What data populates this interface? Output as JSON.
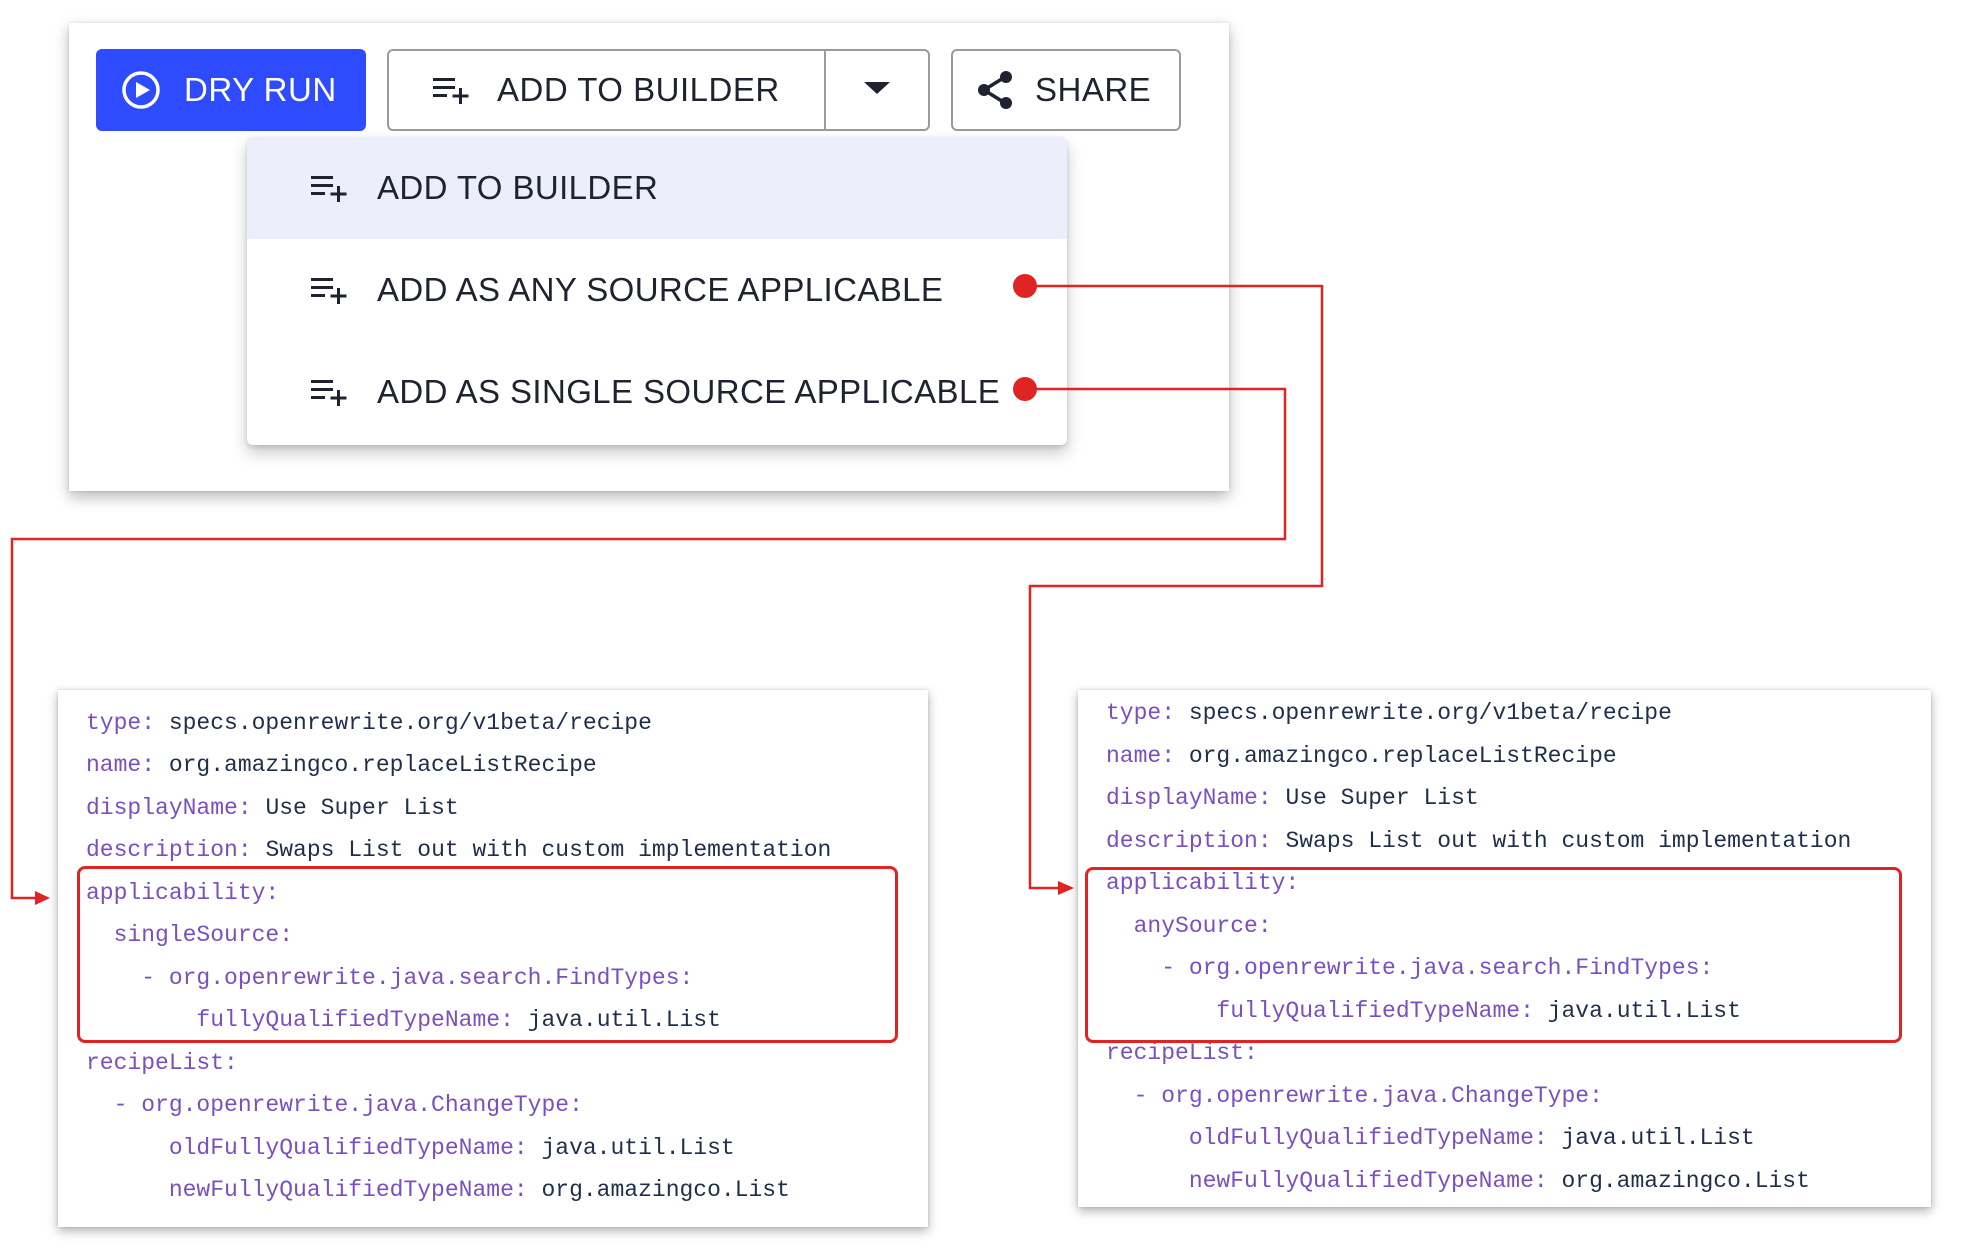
{
  "toolbar": {
    "dry_run_label": "DRY RUN",
    "add_to_builder_label": "ADD TO BUILDER",
    "share_label": "SHARE"
  },
  "menu": {
    "items": [
      {
        "label": "ADD TO BUILDER",
        "selected": true
      },
      {
        "label": "ADD AS ANY SOURCE APPLICABLE",
        "selected": false
      },
      {
        "label": "ADD AS SINGLE SOURCE APPLICABLE",
        "selected": false
      }
    ]
  },
  "code_single": {
    "lines": [
      {
        "key": "type:",
        "value": " specs.openrewrite.org/v1beta/recipe"
      },
      {
        "key": "name:",
        "value": " org.amazingco.replaceListRecipe"
      },
      {
        "key": "displayName:",
        "value": " Use Super List"
      },
      {
        "key": "description:",
        "value": " Swaps List out with custom implementation"
      },
      {
        "key": "applicability:",
        "value": ""
      },
      {
        "key": "  singleSource:",
        "value": ""
      },
      {
        "key": "    - org.openrewrite.java.search.FindTypes:",
        "value": ""
      },
      {
        "key": "        fullyQualifiedTypeName:",
        "value": " java.util.List"
      },
      {
        "key": "recipeList:",
        "value": ""
      },
      {
        "key": "  - org.openrewrite.java.ChangeType:",
        "value": ""
      },
      {
        "key": "      oldFullyQualifiedTypeName:",
        "value": " java.util.List"
      },
      {
        "key": "      newFullyQualifiedTypeName:",
        "value": " org.amazingco.List"
      }
    ]
  },
  "code_any": {
    "lines": [
      {
        "key": "type:",
        "value": " specs.openrewrite.org/v1beta/recipe"
      },
      {
        "key": "name:",
        "value": " org.amazingco.replaceListRecipe"
      },
      {
        "key": "displayName:",
        "value": " Use Super List"
      },
      {
        "key": "description:",
        "value": " Swaps List out with custom implementation"
      },
      {
        "key": "applicability:",
        "value": ""
      },
      {
        "key": "  anySource:",
        "value": ""
      },
      {
        "key": "    - org.openrewrite.java.search.FindTypes:",
        "value": ""
      },
      {
        "key": "        fullyQualifiedTypeName:",
        "value": " java.util.List"
      },
      {
        "key": "recipeList:",
        "value": ""
      },
      {
        "key": "  - org.openrewrite.java.ChangeType:",
        "value": ""
      },
      {
        "key": "      oldFullyQualifiedTypeName:",
        "value": " java.util.List"
      },
      {
        "key": "      newFullyQualifiedTypeName:",
        "value": " org.amazingco.List"
      }
    ]
  },
  "colors": {
    "primary": "#2f4bff",
    "code_key": "#7a4fc0",
    "code_value": "#1f2f4a",
    "annotation": "#e02424",
    "menu_selected": "#eceffb"
  },
  "icons": {
    "dry_run": "play-circle-icon",
    "add": "playlist-add-icon",
    "caret": "caret-down-icon",
    "share": "share-icon"
  }
}
